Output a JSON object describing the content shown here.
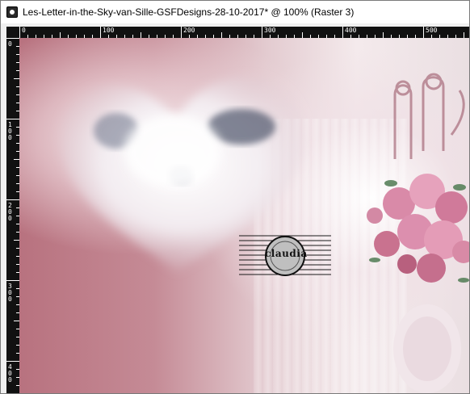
{
  "window": {
    "title": "Les-Letter-in-the-Sky-van-Sille-GSFDesigns-28-10-2017* @ 100% (Raster 3)",
    "app_icon": "camera-icon"
  },
  "rulers": {
    "horizontal_labels": [
      "0",
      "100",
      "200",
      "300",
      "400",
      "500"
    ],
    "vertical_labels": [
      "0",
      "100",
      "200",
      "300",
      "400"
    ]
  },
  "canvas": {
    "watermark_text": "claudia",
    "palette": {
      "mauve": "#b6727f",
      "rose": "#d98aa8",
      "cloud": "#ffffff",
      "cloud_shadow": "#5a6478"
    }
  }
}
